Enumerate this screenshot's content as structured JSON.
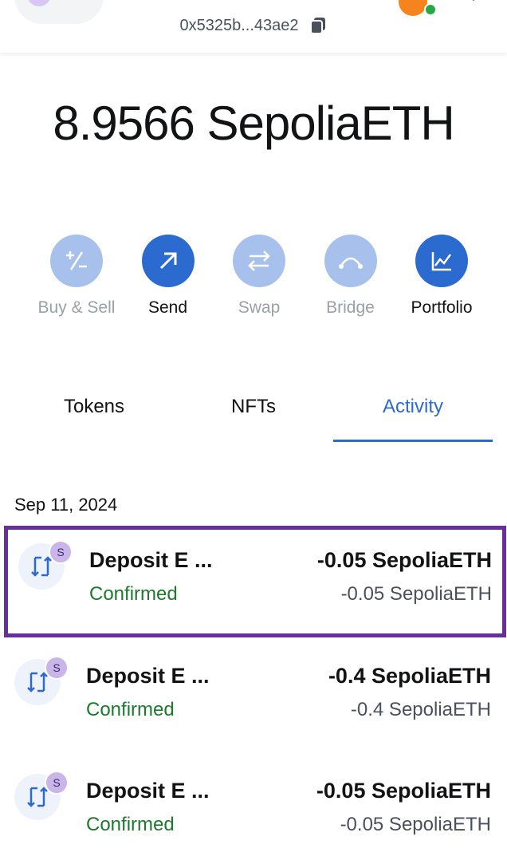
{
  "header": {
    "network_initial": "S",
    "account_address": "0x5325b...43ae2"
  },
  "balance": {
    "amount": "8.9566",
    "symbol": "SepoliaETH"
  },
  "actions": [
    {
      "label": "Buy & Sell",
      "state": "disabled",
      "icon": "buy-sell-icon"
    },
    {
      "label": "Send",
      "state": "enabled",
      "icon": "send-arrow-icon"
    },
    {
      "label": "Swap",
      "state": "disabled",
      "icon": "swap-icon"
    },
    {
      "label": "Bridge",
      "state": "disabled",
      "icon": "bridge-icon"
    },
    {
      "label": "Portfolio",
      "state": "enabled",
      "icon": "portfolio-chart-icon"
    }
  ],
  "tabs": [
    {
      "label": "Tokens",
      "active": false
    },
    {
      "label": "NFTs",
      "active": false
    },
    {
      "label": "Activity",
      "active": true
    }
  ],
  "activity": {
    "date": "Sep 11, 2024",
    "items": [
      {
        "title": "Deposit E ...",
        "status": "Confirmed",
        "amount": "-0.05 SepoliaETH",
        "fiat": "-0.05 SepoliaETH",
        "badge": "S",
        "highlighted": true
      },
      {
        "title": "Deposit E ...",
        "status": "Confirmed",
        "amount": "-0.4 SepoliaETH",
        "fiat": "-0.4 SepoliaETH",
        "badge": "S",
        "highlighted": false
      },
      {
        "title": "Deposit E ...",
        "status": "Confirmed",
        "amount": "-0.05 SepoliaETH",
        "fiat": "-0.05 SepoliaETH",
        "badge": "S",
        "highlighted": false
      }
    ]
  },
  "colors": {
    "primary": "#2b6bd0",
    "primary_disabled": "#a7c1ec",
    "confirmed": "#1c7a2c",
    "highlight_border": "#6a2f9e"
  }
}
